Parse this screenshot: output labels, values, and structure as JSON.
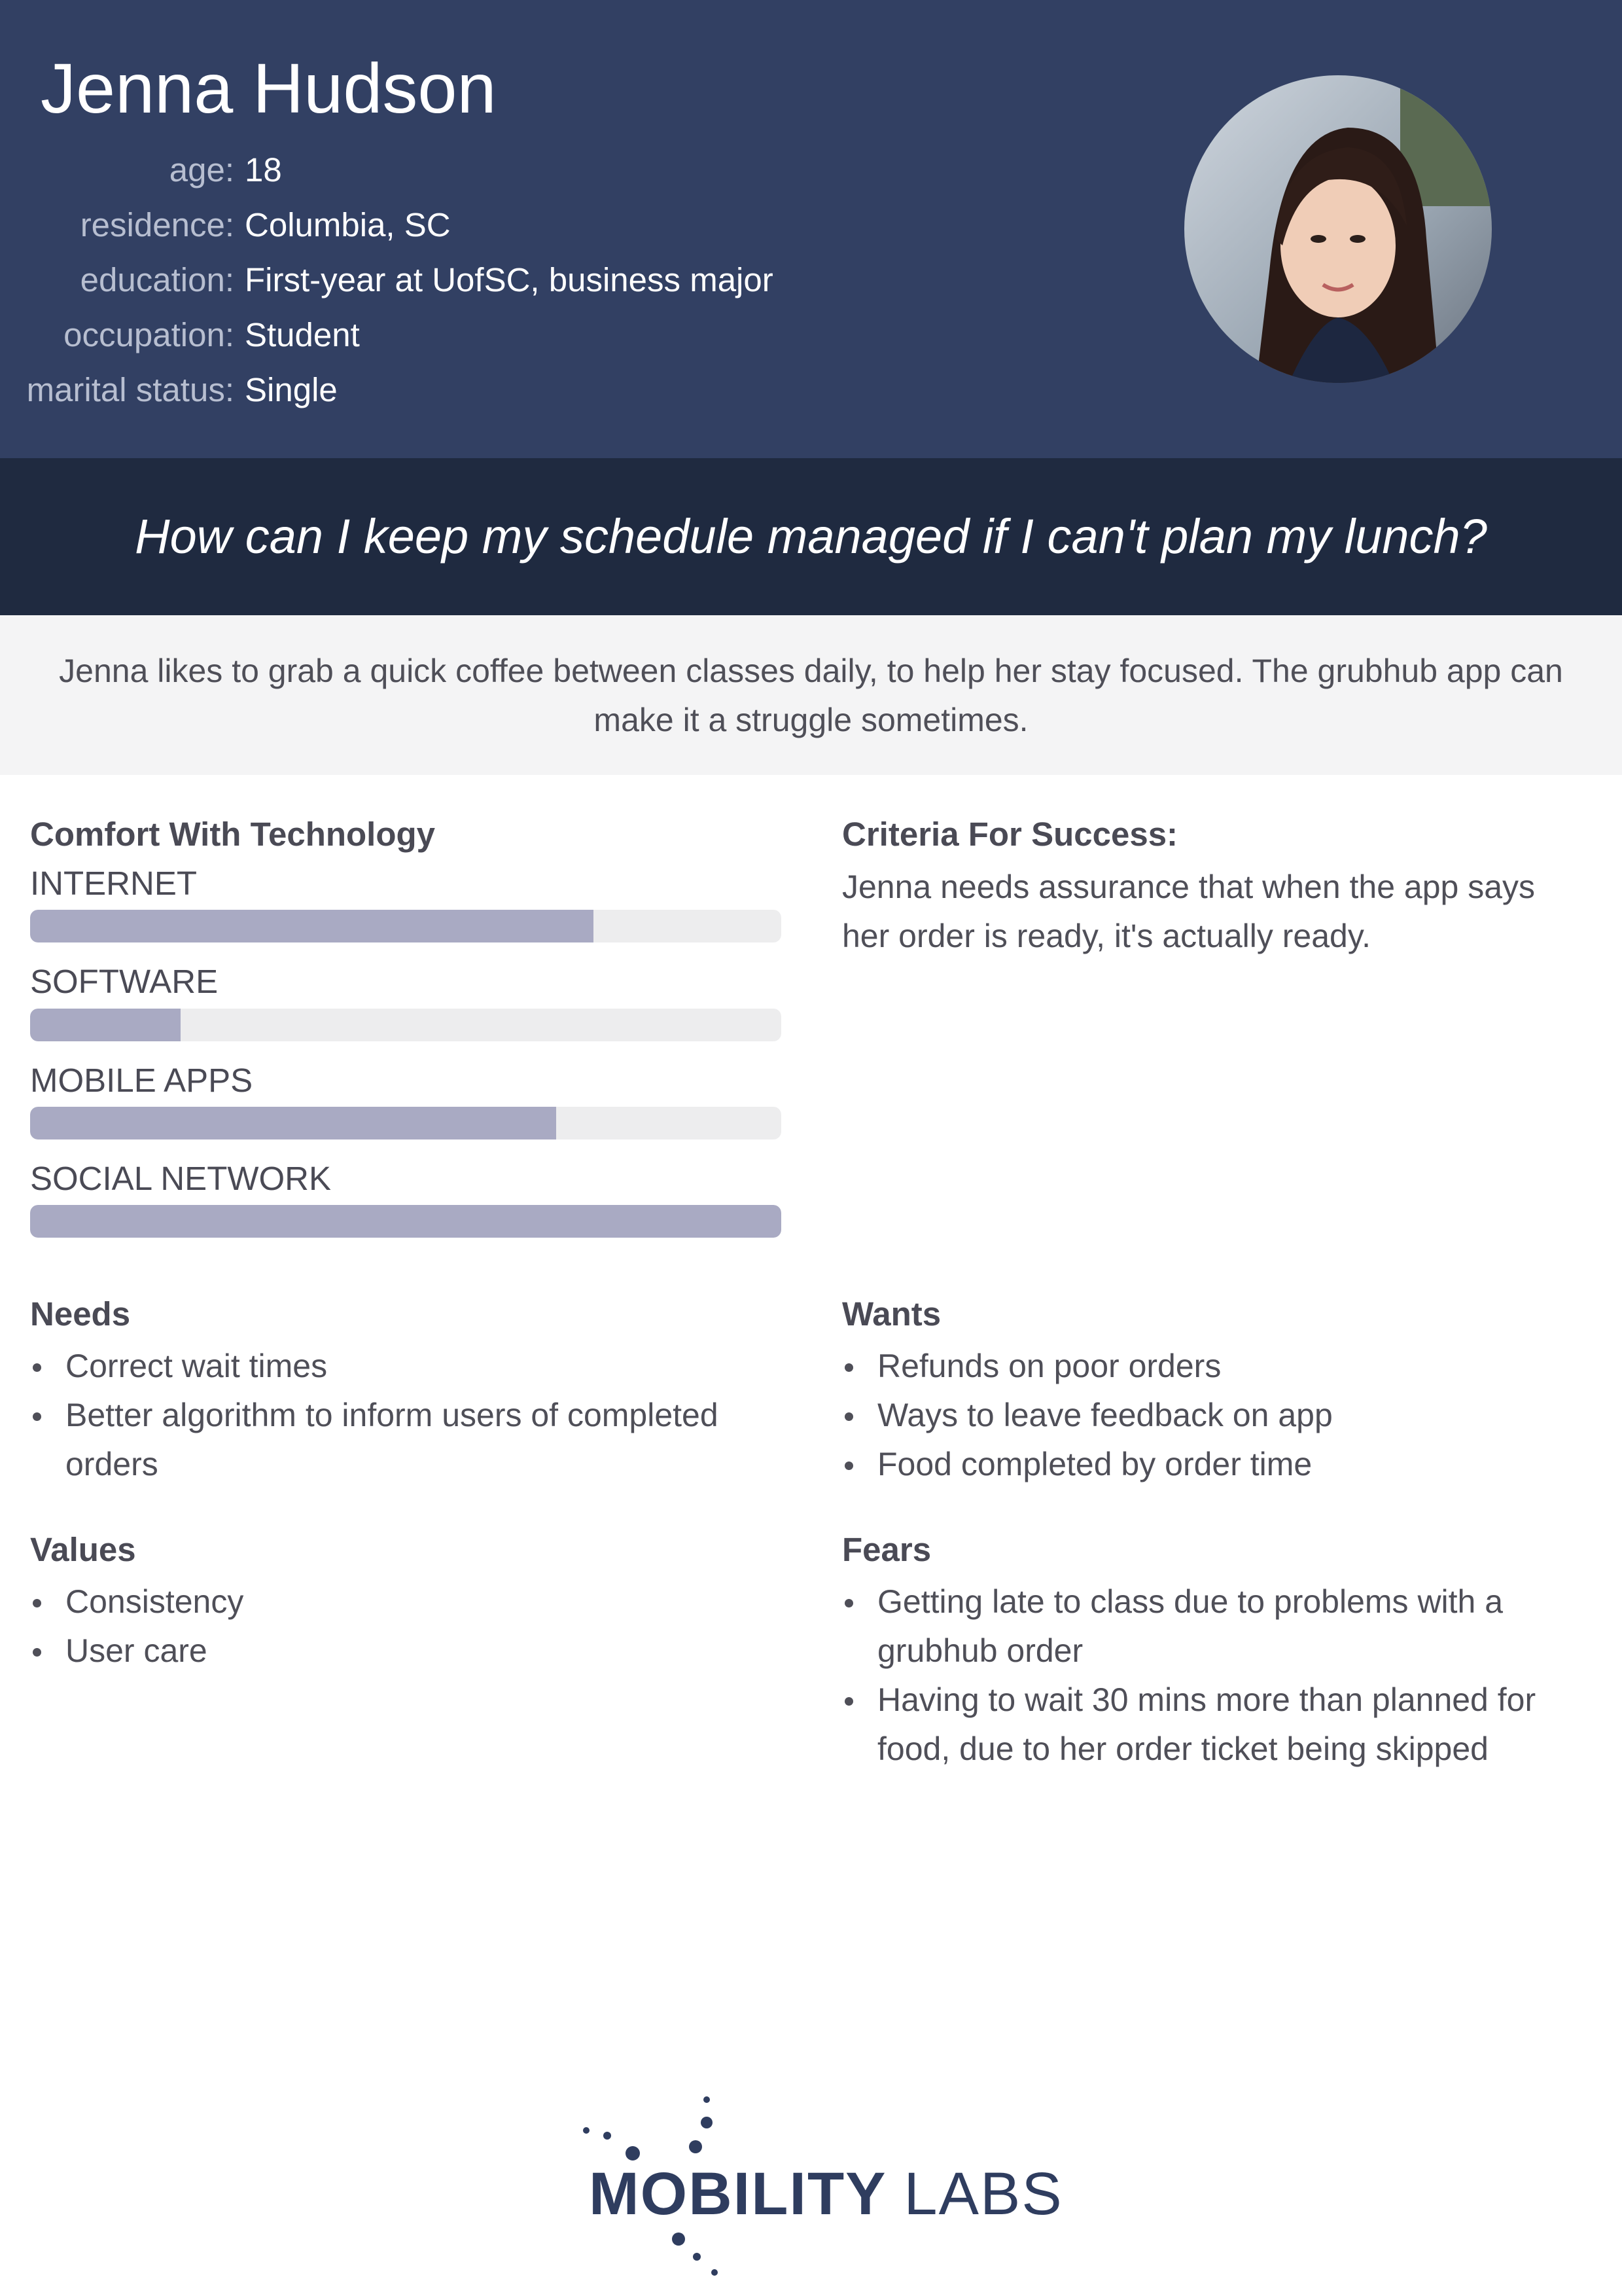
{
  "persona": {
    "name": "Jenna Hudson",
    "details": [
      {
        "label": "age:",
        "value": "18"
      },
      {
        "label": "residence:",
        "value": "Columbia, SC"
      },
      {
        "label": "education:",
        "value": "First-year at UofSC, business major"
      },
      {
        "label": "occupation:",
        "value": "Student"
      },
      {
        "label": "marital status:",
        "value": "Single"
      }
    ]
  },
  "quote": "How can I keep my schedule managed if I can't plan my lunch?",
  "description": "Jenna likes to grab a quick coffee between classes daily, to help her stay focused. The grubhub app can make it a struggle sometimes.",
  "tech": {
    "title": "Comfort With Technology",
    "items": [
      {
        "label": "INTERNET",
        "level": 0.75
      },
      {
        "label": "SOFTWARE",
        "level": 0.2
      },
      {
        "label": "MOBILE APPS",
        "level": 0.7
      },
      {
        "label": "SOCIAL NETWORK",
        "level": 1.0
      }
    ]
  },
  "criteria": {
    "title": "Criteria For Success:",
    "text": "Jenna needs assurance that when the app says her order is ready, it's actually ready."
  },
  "needs": {
    "title": "Needs",
    "items": [
      "Correct wait times",
      "Better algorithm to inform users of completed orders"
    ]
  },
  "wants": {
    "title": "Wants",
    "items": [
      "Refunds on poor orders",
      "Ways to leave feedback on app",
      "Food completed by order time"
    ]
  },
  "values": {
    "title": "Values",
    "items": [
      "Consistency",
      "User care"
    ]
  },
  "fears": {
    "title": "Fears",
    "items": [
      "Getting late to class due to problems with a grubhub order",
      "Having to wait 30 mins more than planned for food, due to her order ticket being skipped"
    ]
  },
  "logo": {
    "part1": "MOBILITY",
    "part2": "LABS"
  },
  "colors": {
    "header": "#324063",
    "quote_band": "#1f2a40",
    "bar_fill": "#a9aac3",
    "bar_track": "#ededee"
  }
}
